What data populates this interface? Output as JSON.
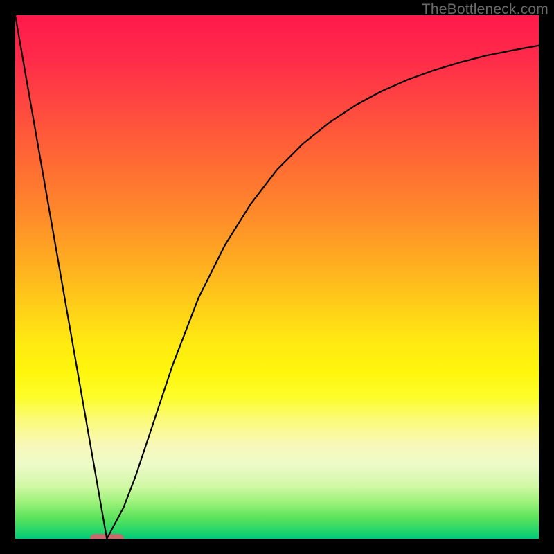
{
  "watermark": "TheBottleneck.com",
  "marker": {
    "x_center_frac": 0.175,
    "width_frac": 0.065
  },
  "chart_data": {
    "type": "line",
    "title": "",
    "xlabel": "",
    "ylabel": "",
    "xlim": [
      0,
      1
    ],
    "ylim": [
      0,
      1
    ],
    "x": [
      0.0,
      0.05,
      0.1,
      0.143,
      0.175,
      0.207,
      0.23,
      0.26,
      0.3,
      0.35,
      0.4,
      0.45,
      0.5,
      0.55,
      0.6,
      0.65,
      0.7,
      0.75,
      0.8,
      0.85,
      0.9,
      0.95,
      1.0
    ],
    "values": [
      1.0,
      0.714,
      0.428,
      0.183,
      0.0,
      0.06,
      0.12,
      0.21,
      0.33,
      0.46,
      0.56,
      0.64,
      0.705,
      0.755,
      0.795,
      0.828,
      0.855,
      0.877,
      0.895,
      0.91,
      0.923,
      0.933,
      0.942
    ],
    "note": "x and values are normalized fractions of the plot area; curve starts at top-left, dips to zero near x≈0.175, then rises asymptotically toward the upper-right."
  }
}
